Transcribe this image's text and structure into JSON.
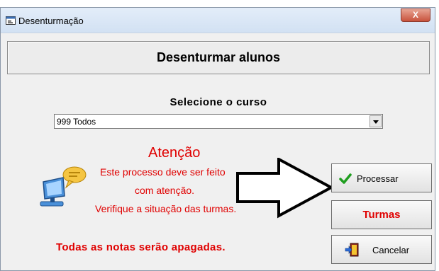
{
  "window": {
    "title": "Desenturmação",
    "close_label": "X"
  },
  "header": {
    "title": "Desenturmar alunos"
  },
  "course": {
    "label": "Selecione o curso",
    "selected_value": "999  Todos"
  },
  "warning": {
    "title": "Atenção",
    "line1": "Este processo deve ser feito",
    "line2": "com atenção.",
    "line3": "Verifique a situação das turmas.",
    "notes_text": "Todas as notas serão apagadas."
  },
  "buttons": {
    "process_label": "Processar",
    "classes_label": "Turmas",
    "cancel_label": "Cancelar"
  },
  "colors": {
    "warning_text": "#e00000",
    "check_green": "#1f9e1f"
  },
  "icons": {
    "app": "form-icon",
    "computer": "computer-speech-icon",
    "process": "checkmark-icon",
    "cancel": "exit-door-icon",
    "pointer": "arrow-right-icon"
  }
}
